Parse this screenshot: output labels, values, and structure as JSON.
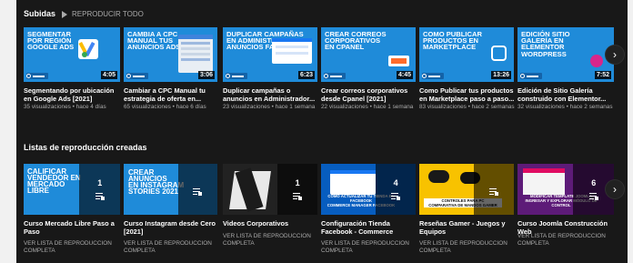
{
  "uploads": {
    "title": "Subidas",
    "play_all": "REPRODUCIR TODO",
    "videos": [
      {
        "thumb_text": "Segmentar\npor región\nGoogle Ads",
        "duration": "4:05",
        "title": "Segmentando por ubicación en Google Ads [2021]",
        "meta": "35 visualizaciones • hace 4 días"
      },
      {
        "thumb_text": "Cambia a CPC\nManual tus\nanuncios ADS",
        "duration": "3:06",
        "title": "Cambiar a CPC Manual tu estrategia de oferta en...",
        "meta": "65 visualizaciones • hace 6 días"
      },
      {
        "thumb_text": "Duplicar Campañas\nen Administrador\nAnuncios Facebook",
        "duration": "6:23",
        "title": "Duplicar campañas o anuncios en Administrador...",
        "meta": "23 visualizaciones • hace 1 semana"
      },
      {
        "thumb_text": "Crear Correos\nCorporativos\nen CPanel",
        "duration": "4:45",
        "title": "Crear correos corporativos desde Cpanel [2021]",
        "meta": "22 visualizaciones • hace 1 semana"
      },
      {
        "thumb_text": "Como Publicar\nProductos en\nMarketplace",
        "duration": "13:26",
        "title": "Como Publicar tus productos en Marketplace paso a paso...",
        "meta": "83 visualizaciones • hace 2 semanas"
      },
      {
        "thumb_text": "Edición Sitio\nGalería en\nElementor\nWordpress",
        "duration": "7:52",
        "title": "Edición de Sitio Galería construido con Elementor...",
        "meta": "32 visualizaciones • hace 2 semanas"
      }
    ]
  },
  "playlists": {
    "title": "Listas de reproducción creadas",
    "items": [
      {
        "thumb_text": "Calificar\nvendedor en\nMercado Libre",
        "count": "1",
        "title": "Curso Mercado Libre Paso a Paso",
        "link": "VER LISTA DE REPRODUCCIÓN COMPLETA"
      },
      {
        "thumb_text": "Crear anuncios\nen Instagram\nStories 2021",
        "count": "",
        "title": "Curso Instagram desde Cero [2021]",
        "link": "VER LISTA DE REPRODUCCIÓN COMPLETA"
      },
      {
        "thumb_text": "",
        "count": "1",
        "title": "Videos Corporativos",
        "link": "VER LISTA DE REPRODUCCIÓN COMPLETA"
      },
      {
        "thumb_text": "COMO ACTUALIZAR TU TIENDA EN FACEBOOK\nCOMMERCE MANAGER FACEBOOK",
        "count": "4",
        "title": "Configuración Tienda Facebook - Commerce Manager Facebook",
        "link": "VER LISTA DE REPRODUCCIÓN COMPLETA"
      },
      {
        "thumb_text": "CONTROLES PARA PC\nCOMPARATIVA DE MANDOS GAMER",
        "count": "",
        "title": "Reseñas Gamer - Juegos y Equipos",
        "link": "VER LISTA DE REPRODUCCIÓN COMPLETA"
      },
      {
        "thumb_text": "MODIFICAR TEMPLATE JOOMLA\nINGRESAR Y EXPLORAR MÓDULO DE CONTROL",
        "count": "6",
        "title": "Curso Joomla Construcción Web",
        "link": "VER LISTA DE REPRODUCCIÓN COMPLETA"
      }
    ]
  },
  "icons": {
    "next": "›",
    "playlist": "playlist-icon"
  }
}
